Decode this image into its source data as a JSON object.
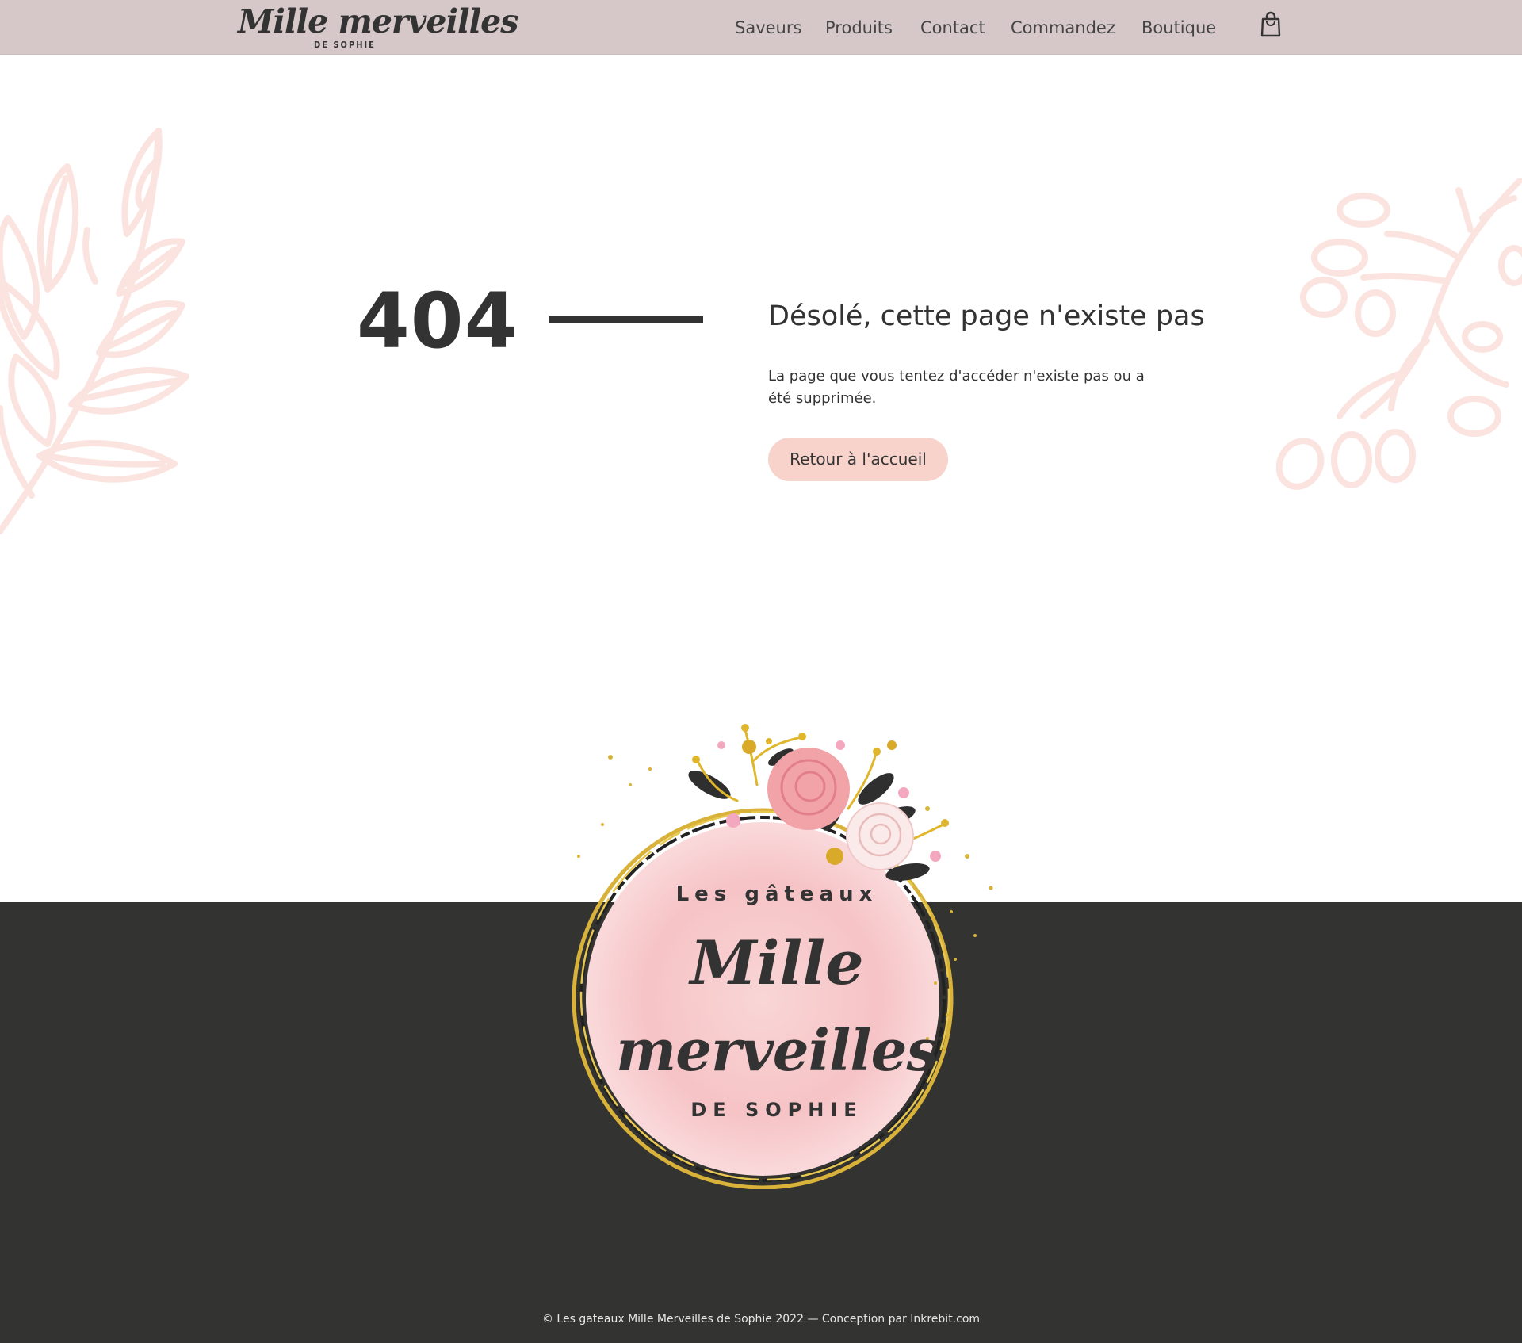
{
  "header": {
    "brand_script": "Mille merveilles",
    "brand_sub": "DE SOPHIE",
    "nav": [
      "Saveurs",
      "Produits",
      "Contact",
      "Commandez",
      "Boutique"
    ],
    "cart_icon": "shopping-bag-icon"
  },
  "error": {
    "code": "404",
    "title": "Désolé, cette page n'existe pas",
    "text": "La page que vous tentez d'accéder n'existe pas ou a été supprimée.",
    "home_button": "Retour à l'accueil"
  },
  "badge": {
    "line1": "Les gâteaux",
    "line2": "Mille",
    "line3": "merveilles",
    "line4": "DE SOPHIE"
  },
  "footer": {
    "copyright": "© Les gateaux Mille Merveilles de Sophie 2022 — Conception par Inkrebit.com"
  },
  "colors": {
    "header_bg": "#d6c8c8",
    "accent_pink": "#f7d3cb",
    "leaf_pink": "#fbe4df",
    "dark": "#333332",
    "gold": "#d9b23a",
    "rose": "#f2a3a8"
  }
}
